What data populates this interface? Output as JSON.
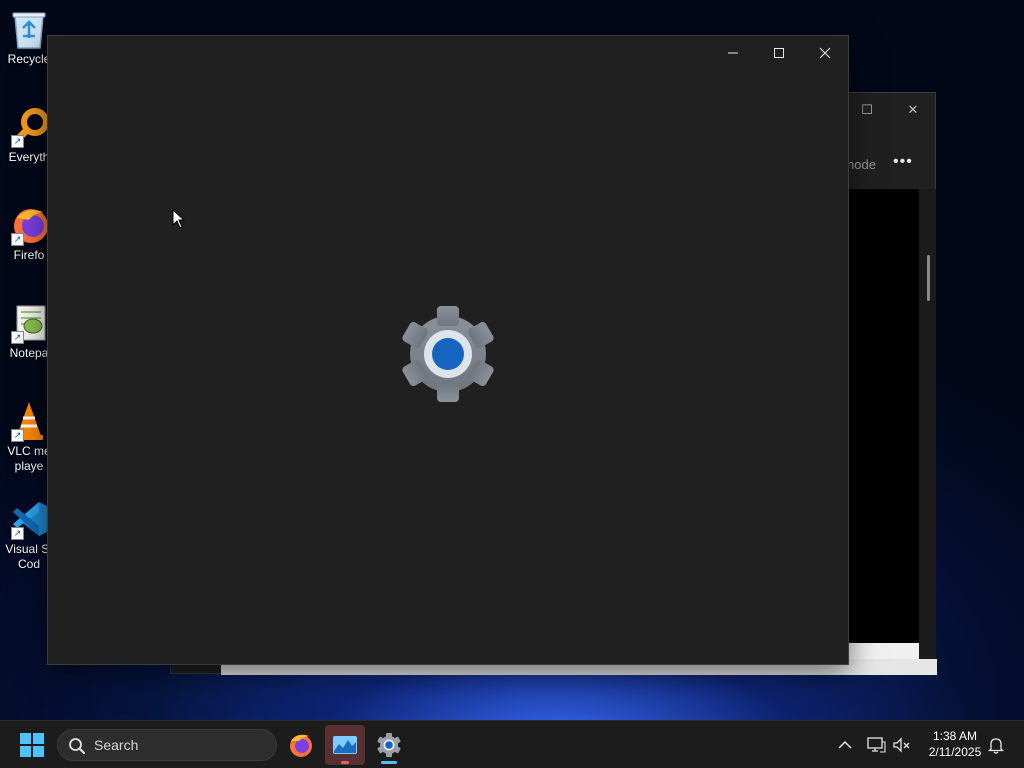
{
  "desktop": {
    "icons": [
      {
        "label": "Recycle",
        "icon": "recycle-bin-icon"
      },
      {
        "label": "Everyth",
        "icon": "everything-search-icon"
      },
      {
        "label": "Firefo",
        "icon": "firefox-icon"
      },
      {
        "label": "Notepa",
        "icon": "notepad-plus-plus-icon"
      },
      {
        "label": "VLC me\nplaye",
        "icon": "vlc-icon"
      },
      {
        "label": "Visual St\nCod",
        "icon": "vscode-icon"
      }
    ]
  },
  "background_window": {
    "visible_text": "node",
    "more_button": "•••",
    "maximize_glyph": "☐",
    "close_glyph": "✕"
  },
  "settings_window": {
    "splash_icon": "settings-gear-icon",
    "controls": [
      "minimize",
      "maximize",
      "close"
    ]
  },
  "taskbar": {
    "start_icon": "windows-start-icon",
    "search_placeholder": "Search",
    "apps": [
      {
        "name": "Firefox",
        "icon": "firefox-icon",
        "state": "pinned"
      },
      {
        "name": "Task Manager",
        "icon": "task-manager-icon",
        "state": "running"
      },
      {
        "name": "Settings",
        "icon": "settings-gear-icon",
        "state": "active"
      }
    ],
    "tray": {
      "icons": [
        "chevron-up-icon",
        "display-icon",
        "speaker-muted-icon",
        "notification-bell-icon"
      ],
      "time": "1:38 AM",
      "date": "2/11/2025"
    }
  },
  "colors": {
    "window_bg": "#202020",
    "taskbar_bg": "#1c1c1c",
    "accent": "#4cc2ff",
    "gear_center": "#1565c0"
  }
}
